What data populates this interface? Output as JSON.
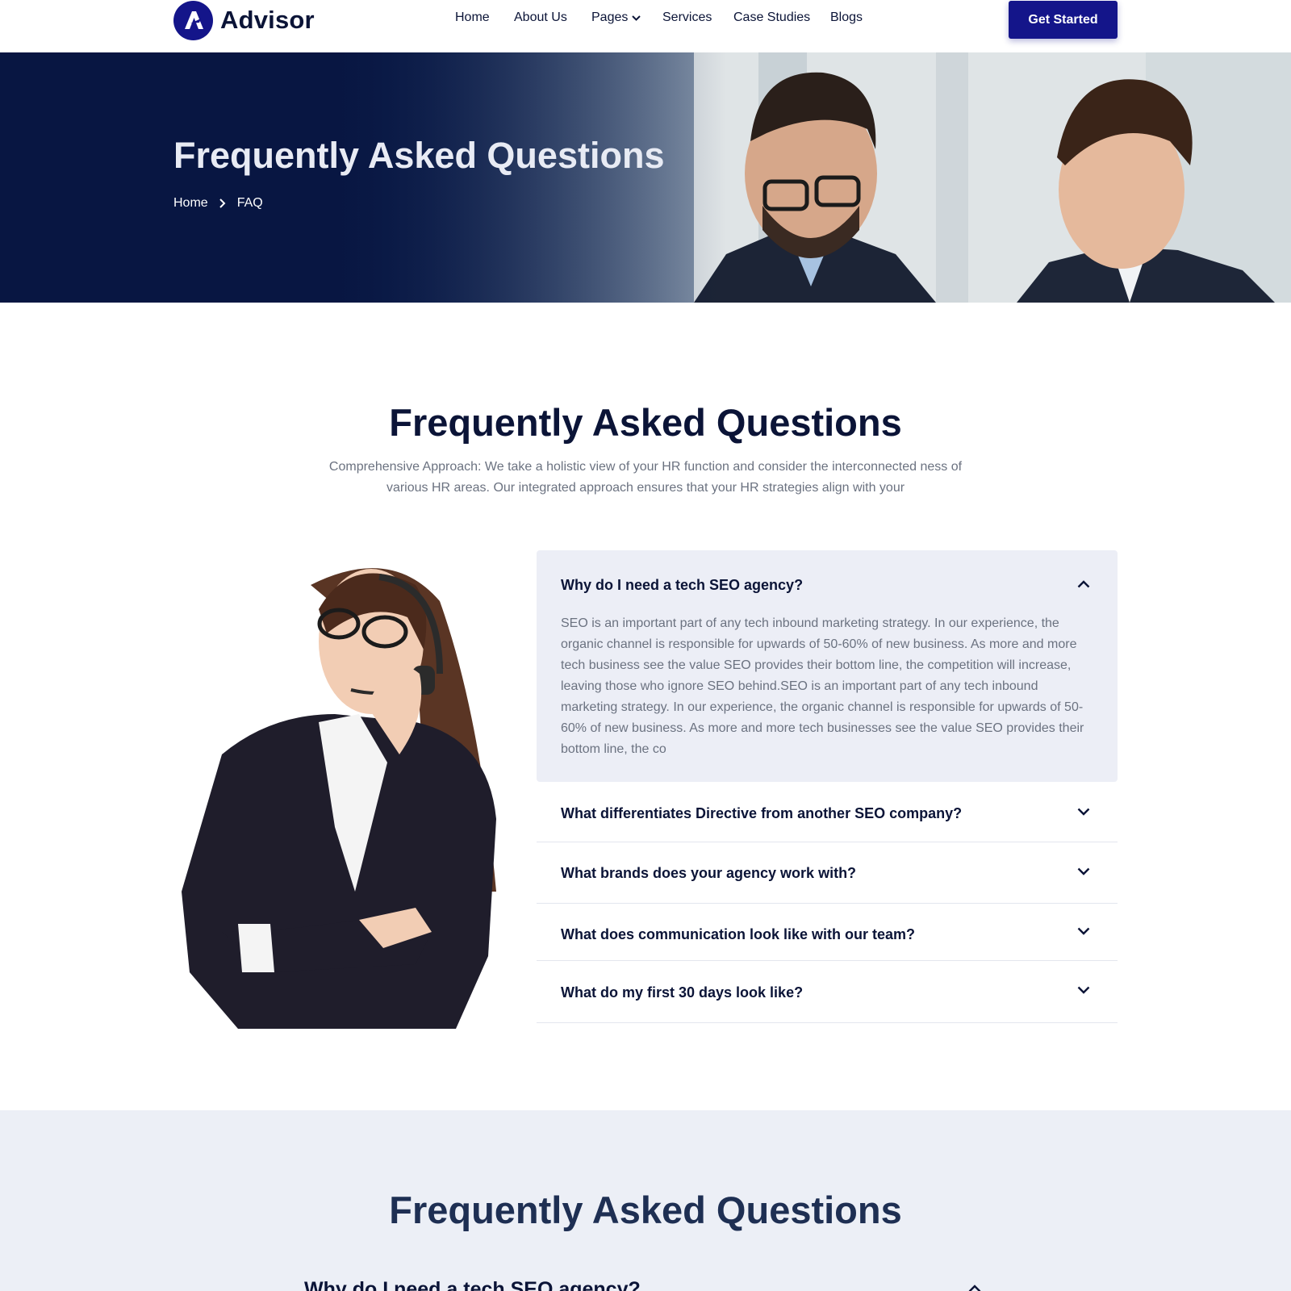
{
  "header": {
    "brand": "Advisor",
    "nav": [
      {
        "label": "Home"
      },
      {
        "label": "About Us"
      },
      {
        "label": "Pages"
      },
      {
        "label": "Services"
      },
      {
        "label": "Case Studies"
      },
      {
        "label": "Blogs"
      }
    ],
    "cta_label": "Get Started"
  },
  "hero": {
    "title": "Frequently Asked Questions",
    "breadcrumb": {
      "home": "Home",
      "current": "FAQ"
    }
  },
  "faq": {
    "title": "Frequently Asked Questions",
    "subtitle": "Comprehensive Approach: We take a holistic view of your HR function and consider the interconnected ness of various HR areas. Our integrated approach ensures that your HR strategies align with your",
    "items": [
      {
        "question": "Why do I need a tech SEO agency?",
        "answer": "SEO is an important part of any tech inbound marketing strategy. In our experience, the organic channel is responsible for upwards of 50-60% of new business. As more and more tech business see the value SEO provides their bottom line, the competition will increase, leaving those who ignore SEO behind.SEO is an important part of any tech inbound marketing strategy. In our experience, the organic channel is responsible for upwards of 50-60% of new business. As more and more tech businesses see the value SEO provides their bottom line, the co",
        "expanded": true
      },
      {
        "question": "What differentiates Directive from another SEO company?",
        "expanded": false
      },
      {
        "question": "What brands does your agency work with?",
        "expanded": false
      },
      {
        "question": "What does communication look like with our team?",
        "expanded": false
      },
      {
        "question": "What do my first 30 days look like?",
        "expanded": false
      }
    ]
  },
  "faq2": {
    "title": "Frequently Asked Questions",
    "first_question": "Why do I need a tech SEO agency?"
  },
  "colors": {
    "brand": "#14158a",
    "heading": "#0b1437",
    "body_text": "#6b7280",
    "hero_overlay": "#0b1a45",
    "accordion_bg": "#eceef6",
    "band_bg": "#eceff6"
  },
  "icons": {
    "logo": "advisor-logo-icon",
    "dropdown": "chevron-down-icon",
    "crumb_sep": "chevron-right-icon",
    "collapse": "chevron-up-icon",
    "expand": "chevron-down-icon"
  }
}
